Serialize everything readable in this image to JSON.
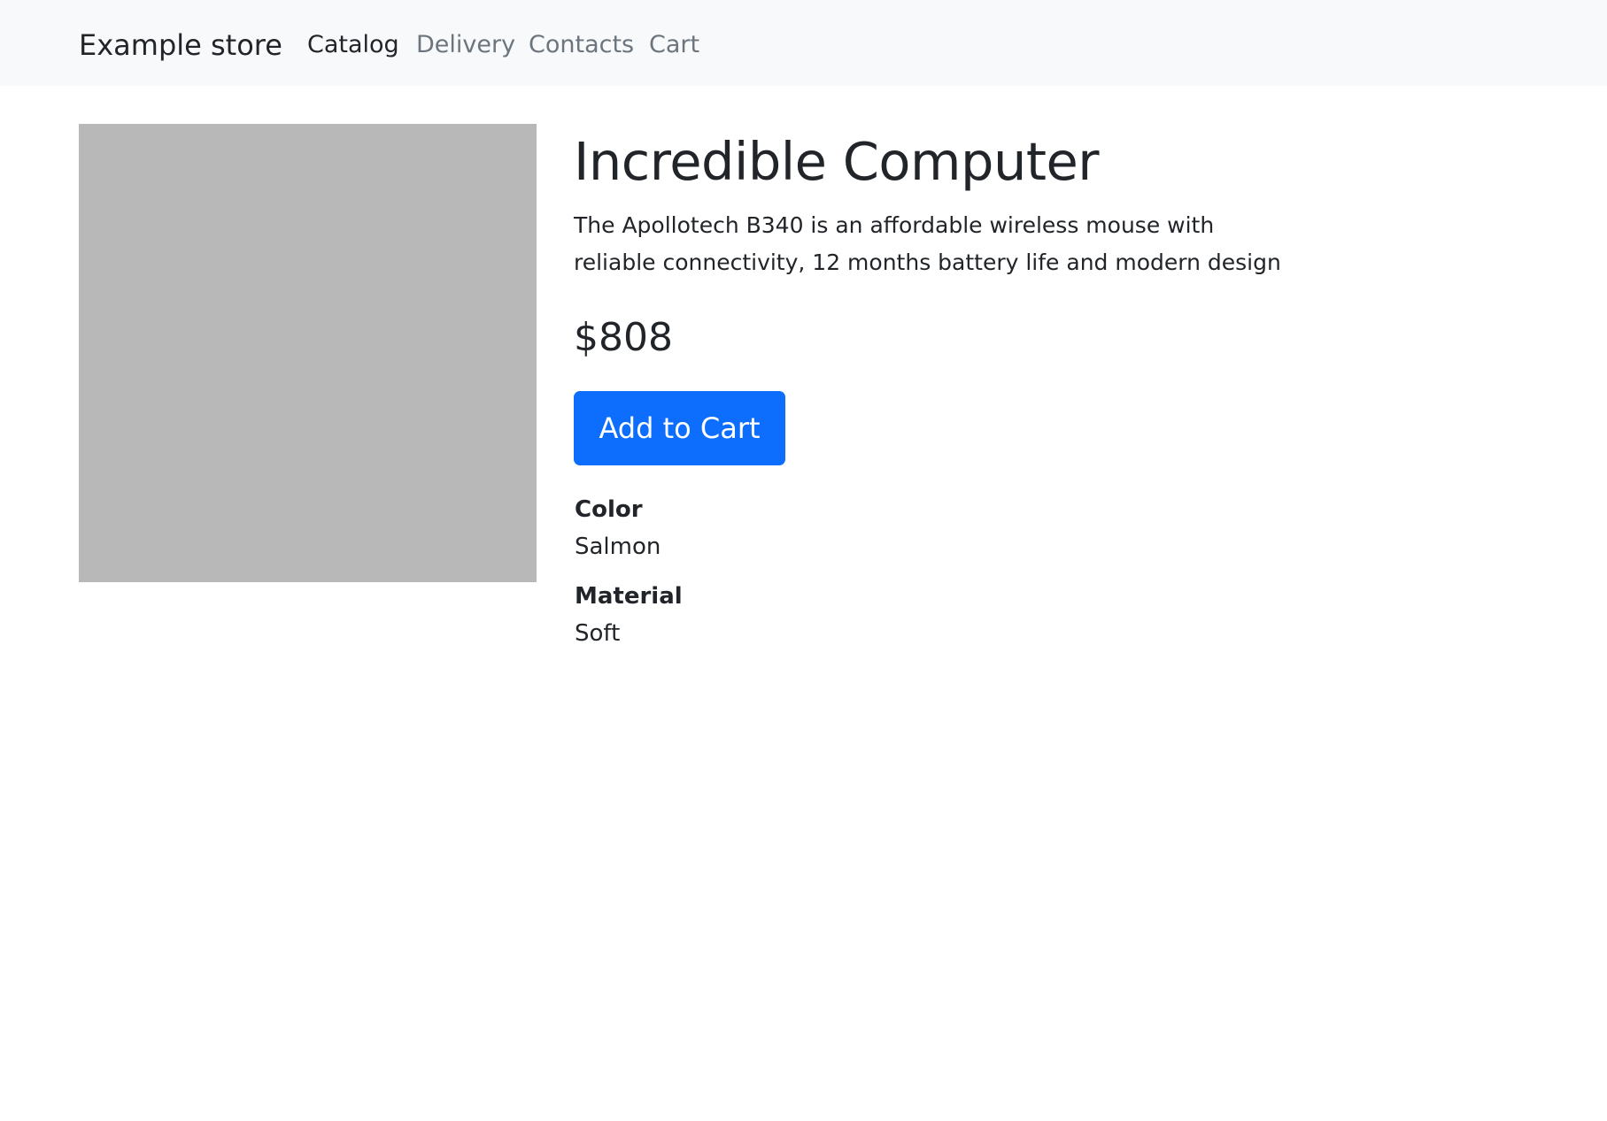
{
  "navbar": {
    "brand": "Example store",
    "items": [
      {
        "label": "Catalog",
        "active": true
      },
      {
        "label": "Delivery",
        "active": false
      },
      {
        "label": "Contacts",
        "active": false
      },
      {
        "label": "Cart",
        "active": false
      }
    ]
  },
  "product": {
    "title": "Incredible Computer",
    "description": "The Apollotech B340 is an affordable wireless mouse with reliable connectivity, 12 months battery life and modern design",
    "price": "$808",
    "add_to_cart_label": "Add to Cart",
    "attributes": [
      {
        "name": "Color",
        "value": "Salmon"
      },
      {
        "name": "Material",
        "value": "Soft"
      }
    ]
  },
  "colors": {
    "navbar_bg": "#f8f9fa",
    "primary": "#0d6efd",
    "image_placeholder": "#b8b8b8",
    "text": "#212529",
    "muted": "#6c757d"
  }
}
